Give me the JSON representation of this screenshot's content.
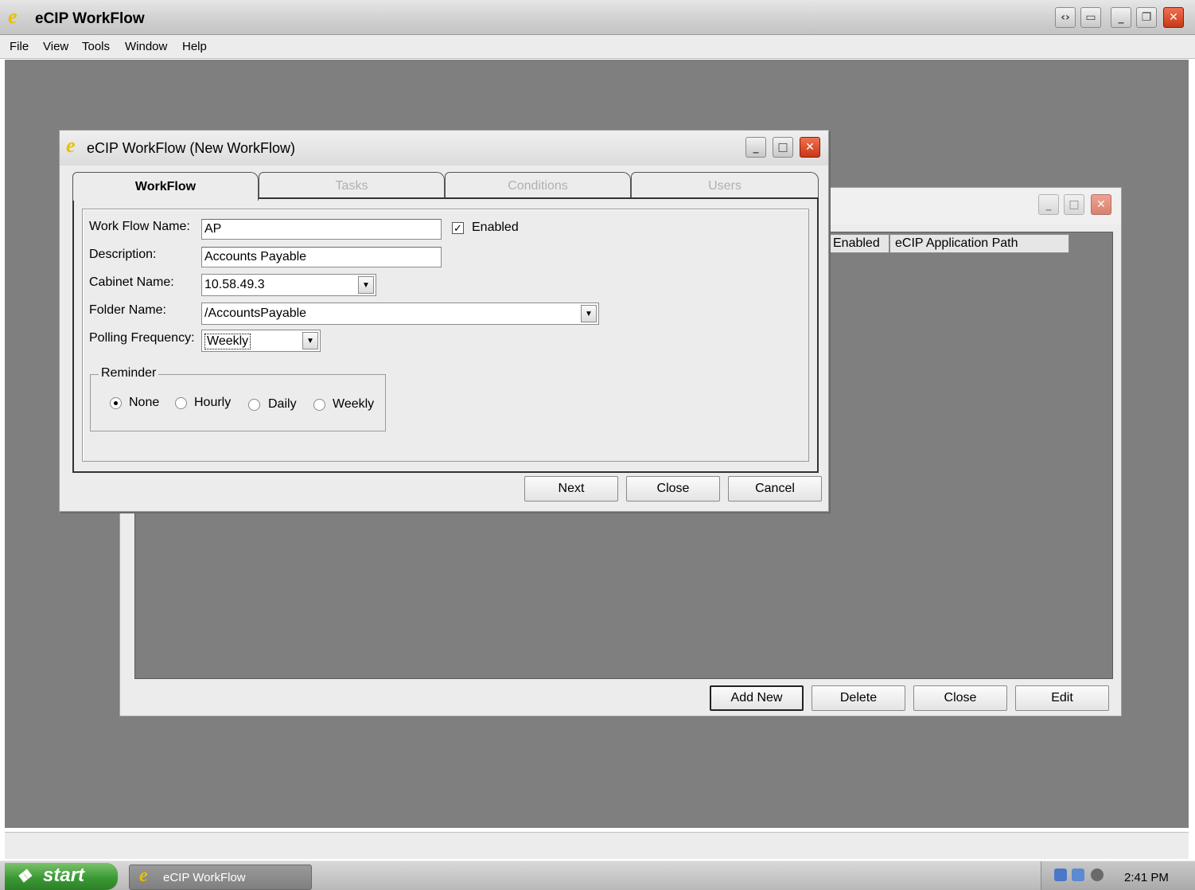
{
  "app": {
    "title": "eCIP WorkFlow",
    "icon_glyph": "e",
    "menu": [
      "File",
      "View",
      "Tools",
      "Window",
      "Help"
    ]
  },
  "back_window": {
    "columns": [
      "Enabled",
      "eCIP Application Path"
    ],
    "buttons": {
      "add_new": "Add New",
      "delete": "Delete",
      "close": "Close",
      "edit": "Edit"
    }
  },
  "dialog": {
    "title": "eCIP WorkFlow (New WorkFlow)",
    "tabs": [
      "WorkFlow",
      "Tasks",
      "Conditions",
      "Users"
    ],
    "active_tab": "WorkFlow",
    "fields": {
      "workflow_name_label": "Work Flow Name:",
      "workflow_name_value": "AP",
      "enabled_label": "Enabled",
      "enabled_checked": true,
      "description_label": "Description:",
      "description_value": "Accounts Payable",
      "cabinet_label": "Cabinet Name:",
      "cabinet_value": "10.58.49.3",
      "folder_label": "Folder Name:",
      "folder_value": "/AccountsPayable",
      "polling_label": "Polling Frequency:",
      "polling_value": "Weekly"
    },
    "reminder": {
      "legend": "Reminder",
      "options": [
        "None",
        "Hourly",
        "Daily",
        "Weekly"
      ],
      "selected": "None"
    },
    "buttons": {
      "next": "Next",
      "close": "Close",
      "cancel": "Cancel"
    }
  },
  "taskbar": {
    "start_label": "start",
    "task_label": "eCIP WorkFlow",
    "clock": "2:41 PM"
  },
  "colors": {
    "workspace": "#7f7f7f",
    "close_button": "#d84a28",
    "start_button": "#3a9a34"
  }
}
